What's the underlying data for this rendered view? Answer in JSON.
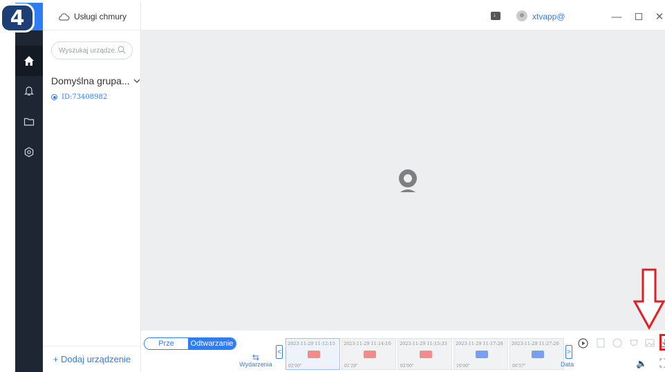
{
  "step_badge": "4",
  "sidebar": {
    "cloud_label": "Usługi chmury",
    "search_placeholder": "Wyszukaj urządze...",
    "group_label": "Domyślna grupa...",
    "device_id": "ID:73408982",
    "add_device_label": "+ Dodaj urządzenie"
  },
  "header": {
    "username": "xtvapp@"
  },
  "playback": {
    "mode_live": "Prze",
    "mode_playback": "Odtwarzanie",
    "events_label": "Wydarzenia",
    "date_label": "Data",
    "clips": [
      {
        "time": "2023-11-29 11:12:15",
        "duration": "02'00\"",
        "color": "#f28b8b"
      },
      {
        "time": "2023-11-29 11:14:10",
        "duration": "01'29\"",
        "color": "#f28b8b"
      },
      {
        "time": "2023-11-29 11:15:33",
        "duration": "02'00\"",
        "color": "#f28b8b"
      },
      {
        "time": "2023-11-29 11:17:28",
        "duration": "10'00\"",
        "color": "#7a9ef0"
      },
      {
        "time": "2023-11-29 11:27:20",
        "duration": "06'57\"",
        "color": "#7a9ef0"
      }
    ]
  },
  "colors": {
    "accent": "#2f7df6",
    "rail": "#1f2633",
    "highlight": "#e02020"
  }
}
